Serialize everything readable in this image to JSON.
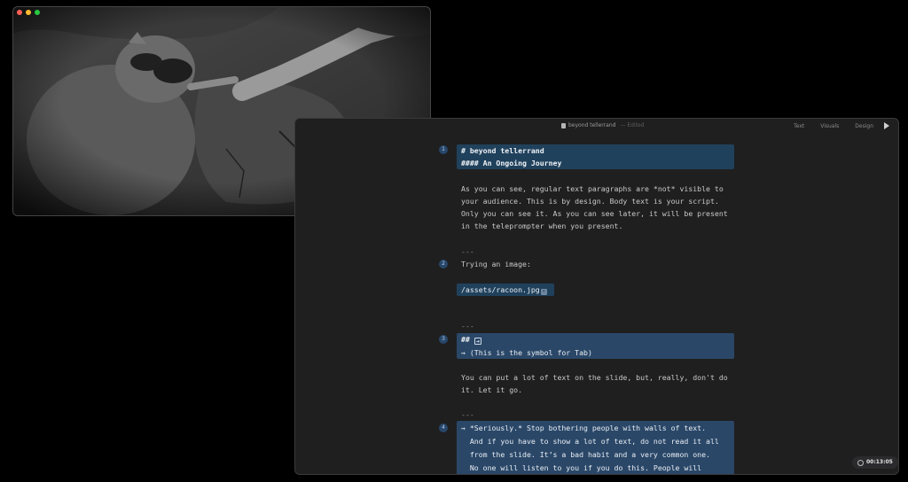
{
  "editor": {
    "doc_title": "beyond tellerrand",
    "doc_subtitle": "— Edited",
    "tabs": [
      "Text",
      "Visuals",
      "Design"
    ],
    "timer": "00:13:05"
  },
  "blocks": [
    {
      "num": "1",
      "lines": [
        "# beyond tellerrand",
        "#### An Ongoing Journey"
      ]
    },
    {
      "num": "2",
      "text": "Trying an image:",
      "image_path": "/assets/racoon.jpg"
    },
    {
      "num": "3",
      "heading": "## ",
      "tab_symbol": "⇥",
      "subline": "→ (This is the symbol for Tab)"
    },
    {
      "num": "4",
      "lines": [
        "→ *Seriously.* Stop bothering people with walls of text.",
        "  And if you have to show a lot of text, do not read it all",
        "  from the slide. It’s a bad habit and a very common one.",
        "  No one will listen to you if you do this. People will"
      ]
    }
  ],
  "body": {
    "para1": [
      "As you can see, regular text paragraphs are *not* visible to",
      "your audience. This is by design. Body text is your script.",
      "Only you can see it. As you can see later, it will be present",
      "in the teleprompter when you present."
    ],
    "para2": [
      "You can put a lot of text on the slide, but, really, don't do",
      "it. Let it go."
    ],
    "separator": "---"
  },
  "preview": {
    "image_icon": "racoon-photo"
  },
  "colors": {
    "block_bg": "#20415c",
    "block_bg_alt": "#2a4768",
    "window_bg": "#1f1f20"
  }
}
